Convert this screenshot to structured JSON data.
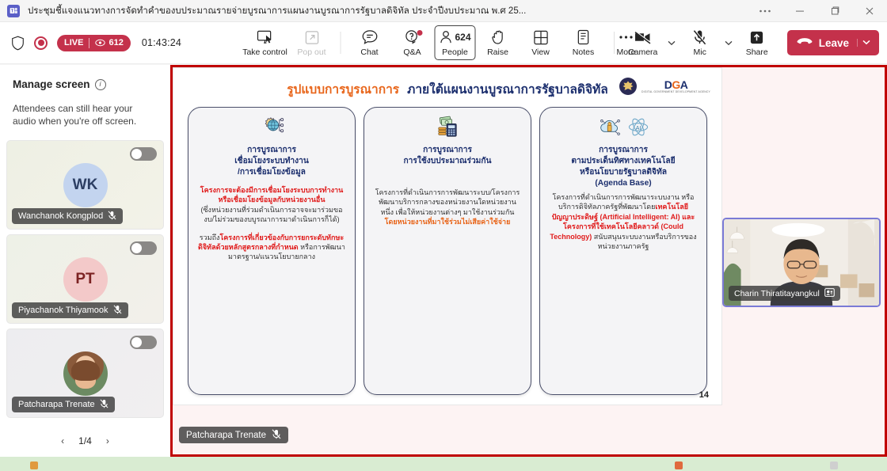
{
  "window": {
    "app_icon": "teams-icon",
    "title": "ประชุมชี้แจงแนวทางการจัดทำคำของบประมาณรายจ่ายบูรณาการแผนงานบูรณาการรัฐบาลดิจิทัล ประจำปีงบประมาณ พ.ศ 25...",
    "controls": {
      "more": "···",
      "minimize": "—",
      "maximize": "❐",
      "close": "✕"
    }
  },
  "toolbar": {
    "shield_icon": "shield-icon",
    "record_icon": "record-icon",
    "live_label": "LIVE",
    "viewers": "612",
    "timer": "01:43:24",
    "items": [
      {
        "label": "Take control",
        "icon": "take-control-icon",
        "state": "enabled"
      },
      {
        "label": "Pop out",
        "icon": "pop-out-icon",
        "state": "disabled"
      },
      {
        "label": "Chat",
        "icon": "chat-icon",
        "state": "enabled"
      },
      {
        "label": "Q&A",
        "icon": "qa-icon",
        "state": "enabled",
        "badge": true
      },
      {
        "label": "People",
        "icon": "people-icon",
        "state": "active",
        "count": "624"
      },
      {
        "label": "Raise",
        "icon": "raise-hand-icon",
        "state": "enabled"
      },
      {
        "label": "View",
        "icon": "view-grid-icon",
        "state": "enabled"
      },
      {
        "label": "Notes",
        "icon": "notes-icon",
        "state": "enabled"
      },
      {
        "label": "More",
        "icon": "more-ellipsis-icon",
        "state": "enabled"
      }
    ],
    "camera": {
      "label": "Camera",
      "icon": "camera-off-icon",
      "muted": true
    },
    "mic": {
      "label": "Mic",
      "icon": "mic-off-icon",
      "muted": true
    },
    "share": {
      "label": "Share",
      "icon": "share-screen-icon"
    },
    "leave": {
      "label": "Leave",
      "icon": "hang-up-icon"
    },
    "accent_red": "#c4314b"
  },
  "sidebar": {
    "title": "Manage screen",
    "info_icon": "info-icon",
    "description": "Attendees can still hear your audio when you're off screen.",
    "tiles": [
      {
        "name": "Wanchanok Kongplod",
        "initials": "WK",
        "avatar_type": "initials-blue",
        "muted": true,
        "toggle": "off"
      },
      {
        "name": "Piyachanok Thiyamook",
        "initials": "PT",
        "avatar_type": "initials-pink",
        "muted": true,
        "toggle": "off"
      },
      {
        "name": "Patcharapa Trenate",
        "initials": "",
        "avatar_type": "photo",
        "muted": true,
        "toggle": "off"
      }
    ],
    "pager": {
      "prev": "‹",
      "value": "1/4",
      "next": "›"
    }
  },
  "stage": {
    "border_color": "#c00000",
    "slide": {
      "title_orange": "รูปแบบการบูรณาการ",
      "title_navy": "ภายใต้แผนงานบูรณาการรัฐบาลดิจิทัล",
      "logo_garuda": "garuda-emblem-icon",
      "logo_dga_main": "DGA",
      "logo_dga_sub": "DIGITAL GOVERNMENT DEVELOPMENT AGENCY",
      "page_number": "14",
      "cards": [
        {
          "icons": [
            "globe-gear-icon"
          ],
          "heading": "การบูรณาการ\nเชื่อมโยงระบบทำงาน\n/การเชื่อมโยงข้อมูล",
          "head_line1": "การบูรณาการ",
          "head_line2": "เชื่อมโยงระบบทำงาน",
          "head_line3": "/การเชื่อมโยงข้อมูล",
          "body_red1": "โครงการจะต้องมีการเชื่อมโยงระบบการทำงานหรือเชื่อมโยงข้อมูลกับหน่วยงานอื่น",
          "body_note": "(ซึ่งหน่วยงานที่ร่วมดำเนินการอาจจะมาร่วมของบ/ไม่ร่วมของบบูรณาการมาดำเนินการก็ได้)",
          "body_plain1": "รวมถึง",
          "body_red2": "โครงการที่เกี่ยวข้องกับการยกระดับทักษะดิจิทัลด้วยหลักสูตรกลางที่กำหนด",
          "body_plain2": "หรือการพัฒนามาตรฐาน/แนวนโยบายกลาง"
        },
        {
          "icons": [
            "money-calculator-icon"
          ],
          "head_line1": "การบูรณาการ",
          "head_line2": "การใช้งบประมาณร่วมกัน",
          "head_line3": "",
          "body_plain1": "โครงการที่ดำเนินการการพัฒนาระบบ/โครงการพัฒนาบริการกลางของหน่วยงานใดหน่วยงานหนึ่ง เพื่อให้หน่วยงานต่างๆ มาใช้งานร่วมกัน",
          "body_orange": "โดยหน่วยงานที่มาใช้ร่วมไม่เสียค่าใช้จ่าย"
        },
        {
          "icons": [
            "cloud-data-icon",
            "ai-atom-icon"
          ],
          "head_line1": "การบูรณาการ",
          "head_line2": "ตามประเด็นทิศทางเทคโนโลยี",
          "head_line3": "หรือนโยบายรัฐบาลดิจิทัล",
          "head_line4": "(Agenda Base)",
          "body_plain1": "โครงการที่ดำเนินการการพัฒนาระบบงาน หรือบริการดิจิทัลภาครัฐที่พัฒนาโดย",
          "body_red1": "เทคโนโลยีปัญญาประดิษฐ์ (Artificial Intelligent: AI) และโครงการที่ใช้เทคโนโลยีคลาวด์ (Could Technology)",
          "body_plain2": "สนับสนุนระบบงานหรือบริการของหน่วยงานภาครัฐ"
        }
      ]
    },
    "presenter_name": "Patcharapa Trenate",
    "presenter_muted": true,
    "video_tile": {
      "name": "Charin Thiratitayangkul",
      "share_icon": "presenting-icon",
      "border_color": "#7a7ad6"
    }
  }
}
